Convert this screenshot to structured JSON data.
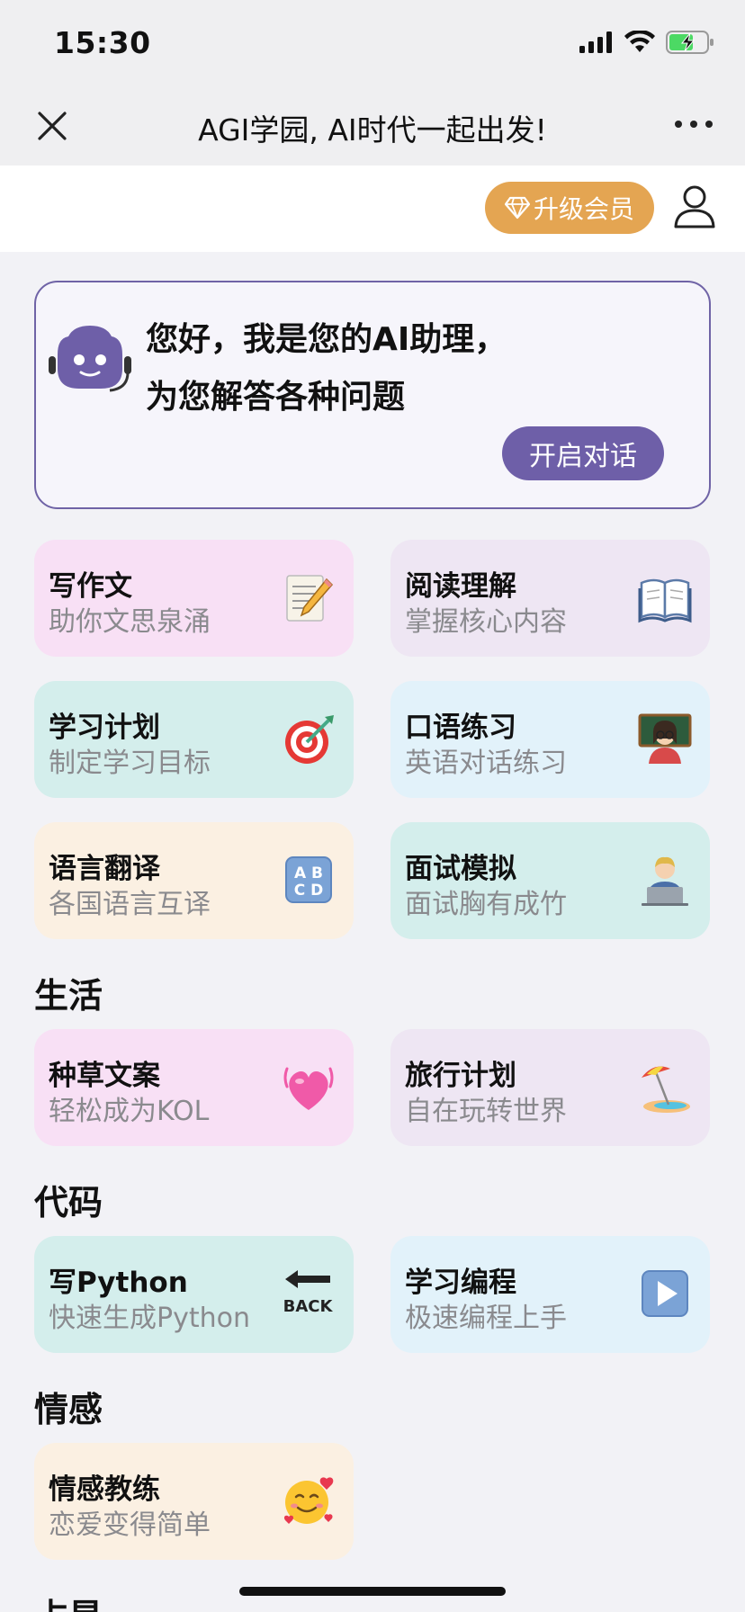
{
  "status": {
    "time": "15:30"
  },
  "nav": {
    "title": "AGI学园, AI时代一起出发!"
  },
  "top": {
    "vip_label": "升级会员"
  },
  "assistant": {
    "line1": "您好，我是您的AI助理，",
    "line2": "为您解答各种问题",
    "button": "开启对话"
  },
  "cards": [
    {
      "title": "写作文",
      "sub": "助你文思泉涌",
      "icon": "memo-icon",
      "bg": "#f8e0f5"
    },
    {
      "title": "阅读理解",
      "sub": "掌握核心内容",
      "icon": "open-book-icon",
      "bg": "#eee6f3"
    },
    {
      "title": "学习计划",
      "sub": "制定学习目标",
      "icon": "dart-target-icon",
      "bg": "#d4eeec"
    },
    {
      "title": "口语练习",
      "sub": "英语对话练习",
      "icon": "teacher-icon",
      "bg": "#e2f2fa"
    },
    {
      "title": "语言翻译",
      "sub": "各国语言互译",
      "icon": "abcd-icon",
      "bg": "#fbf0e2"
    },
    {
      "title": "面试模拟",
      "sub": "面试胸有成竹",
      "icon": "technologist-icon",
      "bg": "#d4eeec"
    }
  ],
  "sections": {
    "life": "生活",
    "code": "代码",
    "emotion": "情感",
    "more": "占星"
  },
  "life_cards": [
    {
      "title": "种草文案",
      "sub": "轻松成为KOL",
      "icon": "beating-heart-icon",
      "bg": "#f8e0f5"
    },
    {
      "title": "旅行计划",
      "sub": "自在玩转世界",
      "icon": "beach-umbrella-icon",
      "bg": "#eee6f3"
    }
  ],
  "code_cards": [
    {
      "title": "写Python",
      "sub": "快速生成Python",
      "icon": "back-arrow-icon",
      "bg": "#d4eeec"
    },
    {
      "title": "学习编程",
      "sub": "极速编程上手",
      "icon": "play-button-icon",
      "bg": "#e2f2fa"
    }
  ],
  "emotion_cards": [
    {
      "title": "情感教练",
      "sub": "恋爱变得简单",
      "icon": "smiling-hearts-icon",
      "bg": "#fbf0e2"
    }
  ],
  "colors": {
    "accent": "#6e5fa8",
    "vip": "#e4a552"
  }
}
